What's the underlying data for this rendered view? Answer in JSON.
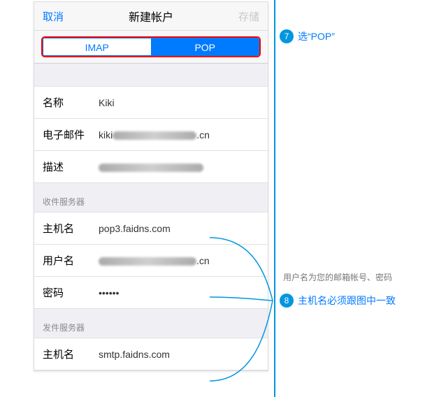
{
  "nav": {
    "cancel": "取消",
    "title": "新建帐户",
    "save": "存储"
  },
  "segmented": {
    "imap": "IMAP",
    "pop": "POP"
  },
  "info": {
    "name_label": "名称",
    "name_value": "Kiki",
    "email_label": "电子邮件",
    "email_prefix": "kiki",
    "email_suffix": ".cn",
    "desc_label": "描述"
  },
  "incoming": {
    "header": "收件服务器",
    "host_label": "主机名",
    "host_value": "pop3.faidns.com",
    "user_label": "用户名",
    "user_suffix": ".cn",
    "pass_label": "密码",
    "pass_value": "••••••"
  },
  "outgoing": {
    "header": "发件服务器",
    "host_label": "主机名",
    "host_value": "smtp.faidns.com"
  },
  "callouts": {
    "c7_num": "7",
    "c7_text": "选“POP”",
    "c8_num": "8",
    "c8_text": "主机名必须跟图中一致",
    "hint": "用户名为您的邮箱帐号、密码"
  }
}
